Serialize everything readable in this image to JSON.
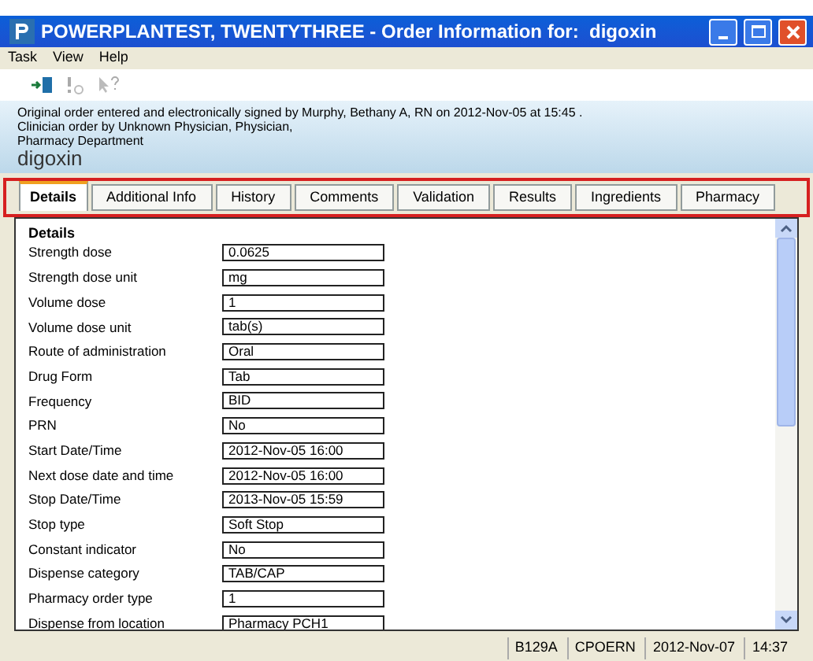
{
  "window": {
    "title": "POWERPLANTEST, TWENTYTHREE - Order Information for:  digoxin"
  },
  "menu": [
    "Task",
    "View",
    "Help"
  ],
  "info": {
    "lines": [
      "Original order entered and electronically signed by Murphy, Bethany A, RN on 2012-Nov-05 at 15:45 .",
      "Clinician order by Unknown Physician, Physician,",
      "Pharmacy Department"
    ],
    "drug": "digoxin"
  },
  "tabs": [
    {
      "label": "Details",
      "selected": true
    },
    {
      "label": "Additional Info",
      "selected": false
    },
    {
      "label": "History",
      "selected": false
    },
    {
      "label": "Comments",
      "selected": false
    },
    {
      "label": "Validation",
      "selected": false
    },
    {
      "label": "Results",
      "selected": false
    },
    {
      "label": "Ingredients",
      "selected": false
    },
    {
      "label": "Pharmacy",
      "selected": false
    }
  ],
  "details": {
    "heading": "Details",
    "fields": [
      {
        "label": "Strength dose",
        "value": "0.0625"
      },
      {
        "label": "Strength dose unit",
        "value": "mg"
      },
      {
        "label": "Volume dose",
        "value": "1"
      },
      {
        "label": "Volume dose unit",
        "value": "tab(s)"
      },
      {
        "label": "Route of administration",
        "value": "Oral"
      },
      {
        "label": "Drug Form",
        "value": "Tab"
      },
      {
        "label": "Frequency",
        "value": "BID"
      },
      {
        "label": "PRN",
        "value": "No"
      },
      {
        "label": "Start Date/Time",
        "value": "2012-Nov-05 16:00"
      },
      {
        "label": "Next dose date and time",
        "value": "2012-Nov-05 16:00"
      },
      {
        "label": "Stop Date/Time",
        "value": "2013-Nov-05 15:59"
      },
      {
        "label": "Stop type",
        "value": "Soft Stop"
      },
      {
        "label": "Constant indicator",
        "value": "No"
      },
      {
        "label": "Dispense category",
        "value": "TAB/CAP"
      },
      {
        "label": "Pharmacy order type",
        "value": "1"
      },
      {
        "label": "Dispense from location",
        "value": "Pharmacy PCH1"
      }
    ]
  },
  "status_bar": [
    "B129A",
    "CPOERN",
    "2012-Nov-07",
    "14:37"
  ]
}
